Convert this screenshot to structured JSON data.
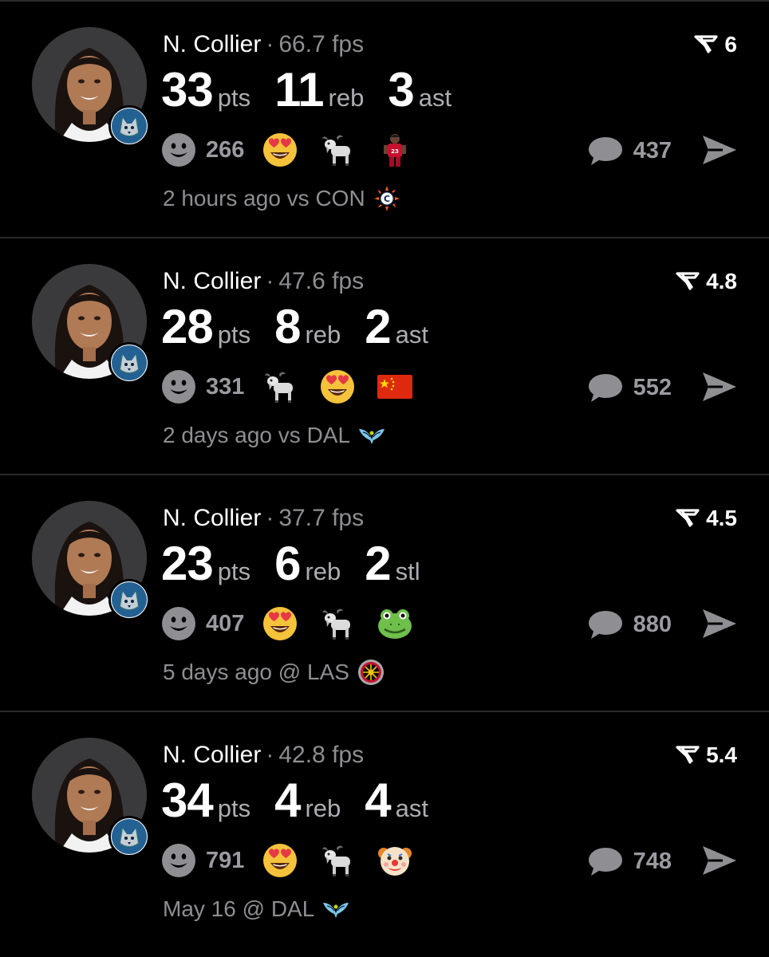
{
  "colors": {
    "background": "#000000",
    "divider": "#2a2a2c",
    "muted_text": "#8e8e93",
    "count_text": "#9a9aa0"
  },
  "posts": [
    {
      "name": "N. Collier",
      "separator": "·",
      "fps": "66.7 fps",
      "score": "6",
      "stats": [
        {
          "value": "33",
          "unit": "pts"
        },
        {
          "value": "11",
          "unit": "reb"
        },
        {
          "value": "3",
          "unit": "ast"
        }
      ],
      "reaction_count": "266",
      "emojis": [
        "heart-eyes-emoji",
        "goat-emoji",
        "player-emoji"
      ],
      "comment_count": "437",
      "time": "2 hours ago",
      "opponent_prefix": "vs",
      "opponent": "CON",
      "opponent_logo": "sun-logo"
    },
    {
      "name": "N. Collier",
      "separator": "·",
      "fps": "47.6 fps",
      "score": "4.8",
      "stats": [
        {
          "value": "28",
          "unit": "pts"
        },
        {
          "value": "8",
          "unit": "reb"
        },
        {
          "value": "2",
          "unit": "ast"
        }
      ],
      "reaction_count": "331",
      "emojis": [
        "goat-emoji",
        "heart-eyes-emoji",
        "china-flag-emoji"
      ],
      "comment_count": "552",
      "time": "2 days ago",
      "opponent_prefix": "vs",
      "opponent": "DAL",
      "opponent_logo": "wings-logo"
    },
    {
      "name": "N. Collier",
      "separator": "·",
      "fps": "37.7 fps",
      "score": "4.5",
      "stats": [
        {
          "value": "23",
          "unit": "pts"
        },
        {
          "value": "6",
          "unit": "reb"
        },
        {
          "value": "2",
          "unit": "stl"
        }
      ],
      "reaction_count": "407",
      "emojis": [
        "heart-eyes-emoji",
        "goat-emoji",
        "frog-emoji"
      ],
      "comment_count": "880",
      "time": "5 days ago",
      "opponent_prefix": "@",
      "opponent": "LAS",
      "opponent_logo": "aces-logo"
    },
    {
      "name": "N. Collier",
      "separator": "·",
      "fps": "42.8 fps",
      "score": "5.4",
      "stats": [
        {
          "value": "34",
          "unit": "pts"
        },
        {
          "value": "4",
          "unit": "reb"
        },
        {
          "value": "4",
          "unit": "ast"
        }
      ],
      "reaction_count": "791",
      "emojis": [
        "heart-eyes-emoji",
        "goat-emoji",
        "clown-emoji"
      ],
      "comment_count": "748",
      "time": "May 16",
      "opponent_prefix": "@",
      "opponent": "DAL",
      "opponent_logo": "wings-logo"
    }
  ]
}
